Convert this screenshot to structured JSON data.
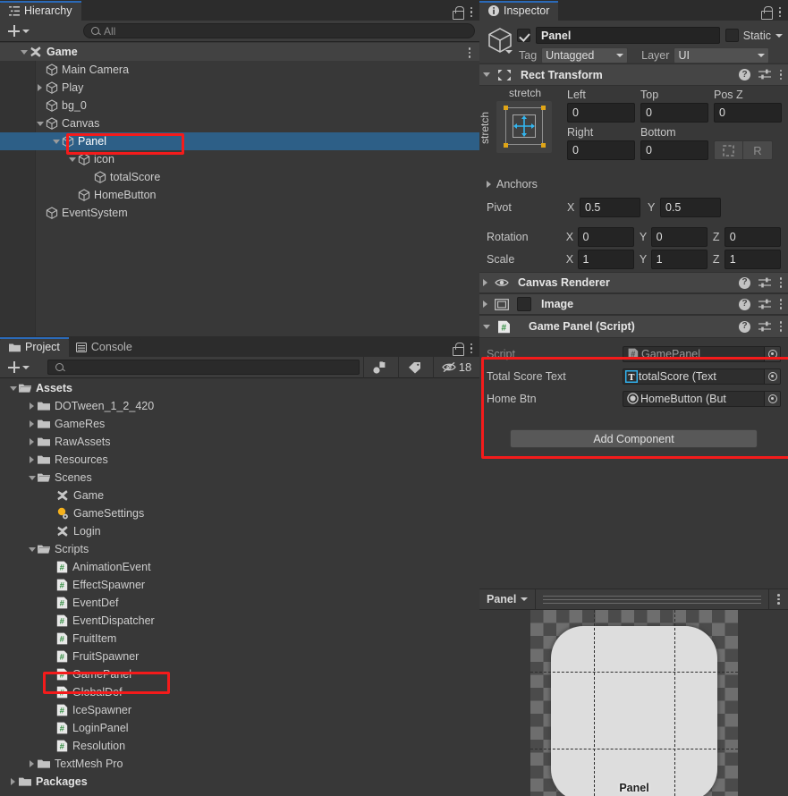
{
  "hierarchy": {
    "tab_label": "Hierarchy",
    "tab_icon": "hierarchy-icon",
    "create_label": "+",
    "search_placeholder": "All",
    "items": [
      {
        "label": "Game",
        "depth": 0,
        "twisty": "down",
        "icon": "unity-scene-icon",
        "bold": true,
        "selected": false
      },
      {
        "label": "Main Camera",
        "depth": 1,
        "twisty": "none",
        "icon": "gameobject-cube-icon",
        "bold": false,
        "selected": false
      },
      {
        "label": "Play",
        "depth": 1,
        "twisty": "right",
        "icon": "gameobject-cube-icon",
        "bold": false,
        "selected": false
      },
      {
        "label": "bg_0",
        "depth": 1,
        "twisty": "none",
        "icon": "gameobject-cube-icon",
        "bold": false,
        "selected": false
      },
      {
        "label": "Canvas",
        "depth": 1,
        "twisty": "down",
        "icon": "gameobject-cube-icon",
        "bold": false,
        "selected": false
      },
      {
        "label": "Panel",
        "depth": 2,
        "twisty": "down",
        "icon": "gameobject-cube-icon",
        "bold": false,
        "selected": true
      },
      {
        "label": "icon",
        "depth": 3,
        "twisty": "down",
        "icon": "gameobject-cube-icon",
        "bold": false,
        "selected": false
      },
      {
        "label": "totalScore",
        "depth": 4,
        "twisty": "none",
        "icon": "gameobject-cube-icon",
        "bold": false,
        "selected": false
      },
      {
        "label": "HomeButton",
        "depth": 3,
        "twisty": "none",
        "icon": "gameobject-cube-icon",
        "bold": false,
        "selected": false
      },
      {
        "label": "EventSystem",
        "depth": 1,
        "twisty": "none",
        "icon": "gameobject-cube-icon",
        "bold": false,
        "selected": false
      }
    ]
  },
  "project": {
    "tabs": [
      {
        "label": "Project",
        "icon": "folder-icon",
        "active": true
      },
      {
        "label": "Console",
        "icon": "console-icon",
        "active": false
      }
    ],
    "create_label": "+",
    "search_placeholder": "",
    "hidden_count": "18",
    "toolbar_icons": [
      "object-filter-icon",
      "label-tag-icon",
      "eye-off-icon"
    ],
    "items": [
      {
        "label": "Assets",
        "depth": 0,
        "twisty": "down",
        "icon": "folder-open-icon",
        "bold": true
      },
      {
        "label": "DOTween_1_2_420",
        "depth": 1,
        "twisty": "right",
        "icon": "folder-icon",
        "bold": false
      },
      {
        "label": "GameRes",
        "depth": 1,
        "twisty": "right",
        "icon": "folder-icon",
        "bold": false
      },
      {
        "label": "RawAssets",
        "depth": 1,
        "twisty": "right",
        "icon": "folder-icon",
        "bold": false
      },
      {
        "label": "Resources",
        "depth": 1,
        "twisty": "right",
        "icon": "folder-icon",
        "bold": false
      },
      {
        "label": "Scenes",
        "depth": 1,
        "twisty": "down",
        "icon": "folder-open-icon",
        "bold": false
      },
      {
        "label": "Game",
        "depth": 2,
        "twisty": "none",
        "icon": "unity-scene-icon",
        "bold": false
      },
      {
        "label": "GameSettings",
        "depth": 2,
        "twisty": "none",
        "icon": "settings-asset-icon",
        "bold": false
      },
      {
        "label": "Login",
        "depth": 2,
        "twisty": "none",
        "icon": "unity-scene-icon",
        "bold": false
      },
      {
        "label": "Scripts",
        "depth": 1,
        "twisty": "down",
        "icon": "folder-open-icon",
        "bold": false
      },
      {
        "label": "AnimationEvent",
        "depth": 2,
        "twisty": "none",
        "icon": "csharp-script-icon",
        "bold": false
      },
      {
        "label": "EffectSpawner",
        "depth": 2,
        "twisty": "none",
        "icon": "csharp-script-icon",
        "bold": false
      },
      {
        "label": "EventDef",
        "depth": 2,
        "twisty": "none",
        "icon": "csharp-script-icon",
        "bold": false
      },
      {
        "label": "EventDispatcher",
        "depth": 2,
        "twisty": "none",
        "icon": "csharp-script-icon",
        "bold": false
      },
      {
        "label": "FruitItem",
        "depth": 2,
        "twisty": "none",
        "icon": "csharp-script-icon",
        "bold": false
      },
      {
        "label": "FruitSpawner",
        "depth": 2,
        "twisty": "none",
        "icon": "csharp-script-icon",
        "bold": false
      },
      {
        "label": "GamePanel",
        "depth": 2,
        "twisty": "none",
        "icon": "csharp-script-icon",
        "bold": false
      },
      {
        "label": "GlobalDef",
        "depth": 2,
        "twisty": "none",
        "icon": "csharp-script-icon",
        "bold": false
      },
      {
        "label": "IceSpawner",
        "depth": 2,
        "twisty": "none",
        "icon": "csharp-script-icon",
        "bold": false
      },
      {
        "label": "LoginPanel",
        "depth": 2,
        "twisty": "none",
        "icon": "csharp-script-icon",
        "bold": false
      },
      {
        "label": "Resolution",
        "depth": 2,
        "twisty": "none",
        "icon": "csharp-script-icon",
        "bold": false
      },
      {
        "label": "TextMesh Pro",
        "depth": 1,
        "twisty": "right",
        "icon": "folder-icon",
        "bold": false
      },
      {
        "label": "Packages",
        "depth": 0,
        "twisty": "right",
        "icon": "folder-icon",
        "bold": true
      }
    ]
  },
  "inspector": {
    "tab_label": "Inspector",
    "tab_icon": "info-icon",
    "object_name": "Panel",
    "enabled": true,
    "static_label": "Static",
    "static_checked": false,
    "tag_label": "Tag",
    "tag_value": "Untagged",
    "layer_label": "Layer",
    "layer_value": "UI",
    "rect_transform": {
      "title": "Rect Transform",
      "anchor_preset_top": "stretch",
      "anchor_preset_side": "stretch",
      "left_label": "Left",
      "left_value": "0",
      "top_label": "Top",
      "top_value": "0",
      "posz_label": "Pos Z",
      "posz_value": "0",
      "right_label": "Right",
      "right_value": "0",
      "bottom_label": "Bottom",
      "bottom_value": "0",
      "blueprint_btn": "blueprint-mode-icon",
      "raw_btn": "R",
      "anchors_label": "Anchors",
      "pivot_label": "Pivot",
      "pivot_x": "0.5",
      "pivot_y": "0.5",
      "rotation_label": "Rotation",
      "rotation_x": "0",
      "rotation_y": "0",
      "rotation_z": "0",
      "scale_label": "Scale",
      "scale_x": "1",
      "scale_y": "1",
      "scale_z": "1",
      "axis_x": "X",
      "axis_y": "Y",
      "axis_z": "Z"
    },
    "canvas_renderer": {
      "title": "Canvas Renderer",
      "icon": "eye-icon"
    },
    "image": {
      "title": "Image",
      "icon": "image-component-icon"
    },
    "game_panel_script": {
      "title": "Game Panel (Script)",
      "icon": "csharp-script-icon",
      "rows": [
        {
          "label": "Script",
          "value": "GamePanel",
          "value_icon": "csharp-script-icon",
          "dimmed": true
        },
        {
          "label": "Total Score Text",
          "value": "totalScore (Text",
          "value_icon": "text-component-icon",
          "dimmed": false
        },
        {
          "label": "Home Btn",
          "value": "HomeButton (But",
          "value_icon": "button-component-icon",
          "dimmed": false
        }
      ]
    },
    "add_component_label": "Add Component",
    "preview": {
      "name": "Panel",
      "sprite_caption": "Panel"
    }
  },
  "colors": {
    "highlight_red": "#f41b1b",
    "selection_blue": "#2d5f87",
    "tab_accent": "#2b6ab8",
    "panel_bg": "#383838",
    "chrome_bg": "#3c3c3c",
    "dark_bg": "#2c2c2c"
  }
}
